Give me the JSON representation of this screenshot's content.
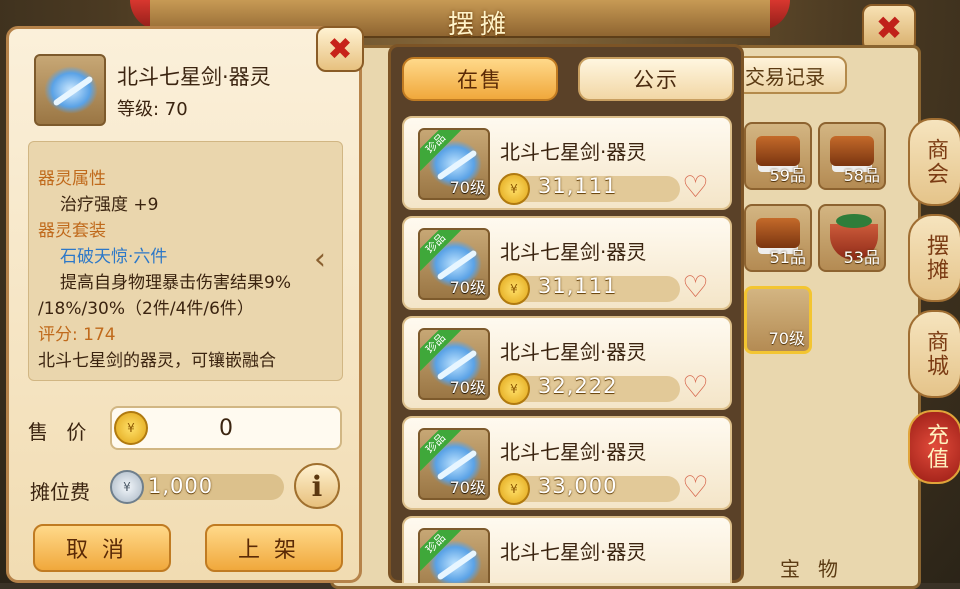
{
  "header": {
    "title": "摆摊",
    "close_icon": "close-icon"
  },
  "tabs": [
    {
      "label": "在售",
      "active": true
    },
    {
      "label": "公示",
      "active": false
    }
  ],
  "back": {
    "history_tab": "交易记录",
    "grid_items": [
      {
        "quality": "59品",
        "icon": "food-icon"
      },
      {
        "quality": "58品",
        "icon": "food-icon"
      },
      {
        "quality": "51品",
        "icon": "food-icon"
      },
      {
        "quality": "53品",
        "icon": "bowl-icon"
      },
      {
        "quality": "70级",
        "icon": "sword-icon"
      }
    ],
    "partial_label": "宝物"
  },
  "side_menu": [
    {
      "label": "商会"
    },
    {
      "label": "摆摊"
    },
    {
      "label": "商城"
    },
    {
      "label": "充值"
    }
  ],
  "listings": [
    {
      "badge": "珍品",
      "level": "70级",
      "name": "北斗七星剑·器灵",
      "price": "31,111"
    },
    {
      "badge": "珍品",
      "level": "70级",
      "name": "北斗七星剑·器灵",
      "price": "31,111"
    },
    {
      "badge": "珍品",
      "level": "70级",
      "name": "北斗七星剑·器灵",
      "price": "32,222"
    },
    {
      "badge": "珍品",
      "level": "70级",
      "name": "北斗七星剑·器灵",
      "price": "33,000"
    },
    {
      "badge": "珍品",
      "level": "",
      "name": "北斗七星剑·器灵",
      "price": ""
    }
  ],
  "detail": {
    "name": "北斗七星剑·器灵",
    "level": "等级: 70",
    "attr_title": "器灵属性",
    "attr_value": "治疗强度 +9",
    "set_title": "器灵套装",
    "set_name": "石破天惊·六件",
    "set_desc_1": "提高自身物理暴击伤害结果9%",
    "set_desc_2": "/18%/30%（2件/4件/6件）",
    "score": "评分: 174",
    "description": "北斗七星剑的器灵，可镶嵌融合",
    "price_label": "售  价",
    "price_value": "0",
    "fee_label": "摊位费",
    "fee_value": "1,000",
    "info_symbol": "i",
    "cancel_label": "取消",
    "confirm_label": "上架"
  },
  "colors": {
    "accent": "#f0a83c",
    "set_name": "#2d78c8",
    "section_title": "#c06a1c",
    "rare_badge": "#3fa83a"
  }
}
